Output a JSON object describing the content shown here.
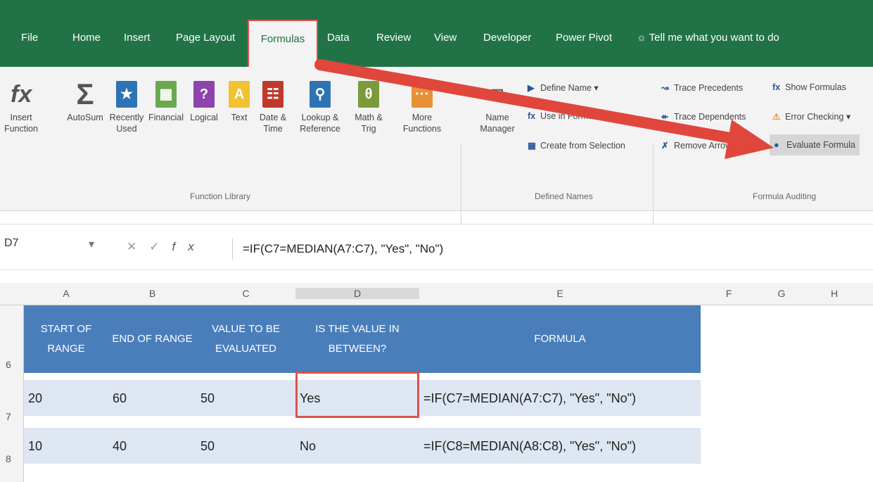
{
  "tabs": [
    "File",
    "Home",
    "Insert",
    "Page Layout",
    "Formulas",
    "Data",
    "Review",
    "View",
    "Developer",
    "Power Pivot"
  ],
  "tell_me": "Tell me what you want to do",
  "ribbon": {
    "insert_function": "Insert Function",
    "autosum": "AutoSum",
    "recently_used": "Recently Used",
    "financial": "Financial",
    "logical": "Logical",
    "text": "Text",
    "date_time": "Date & Time",
    "lookup_reference": "Lookup & Reference",
    "math_trig": "Math & Trig",
    "more_functions": "More Functions",
    "name_manager": "Name Manager",
    "function_library": "Function Library",
    "define_name": "Define Name",
    "use_in_formula": "Use in Formula",
    "create_from_selection": "Create from Selection",
    "defined_names": "Defined Names",
    "trace_precedents": "Trace Precedents",
    "trace_dependents": "Trace Dependents",
    "remove_arrows": "Remove Arrows",
    "show_formulas": "Show Formulas",
    "error_checking": "Error Checking",
    "evaluate_formula": "Evaluate Formula",
    "formula_auditing": "Formula Auditing"
  },
  "formula_bar": {
    "name_box": "D7",
    "formula": "=IF(C7=MEDIAN(A7:C7), \"Yes\", \"No\")"
  },
  "columns": [
    "A",
    "B",
    "C",
    "D",
    "E",
    "F",
    "G",
    "H"
  ],
  "rows": [
    "6",
    "7",
    "8"
  ],
  "headers": [
    "START OF RANGE",
    "END OF RANGE",
    "VALUE TO BE EVALUATED",
    "IS THE VALUE IN BETWEEN?",
    "FORMULA"
  ],
  "data": [
    [
      "20",
      "60",
      "50",
      "Yes",
      "=IF(C7=MEDIAN(A7:C7), \"Yes\", \"No\")"
    ],
    [
      "10",
      "40",
      "50",
      "No",
      "=IF(C8=MEDIAN(A8:C8), \"Yes\", \"No\")"
    ]
  ]
}
